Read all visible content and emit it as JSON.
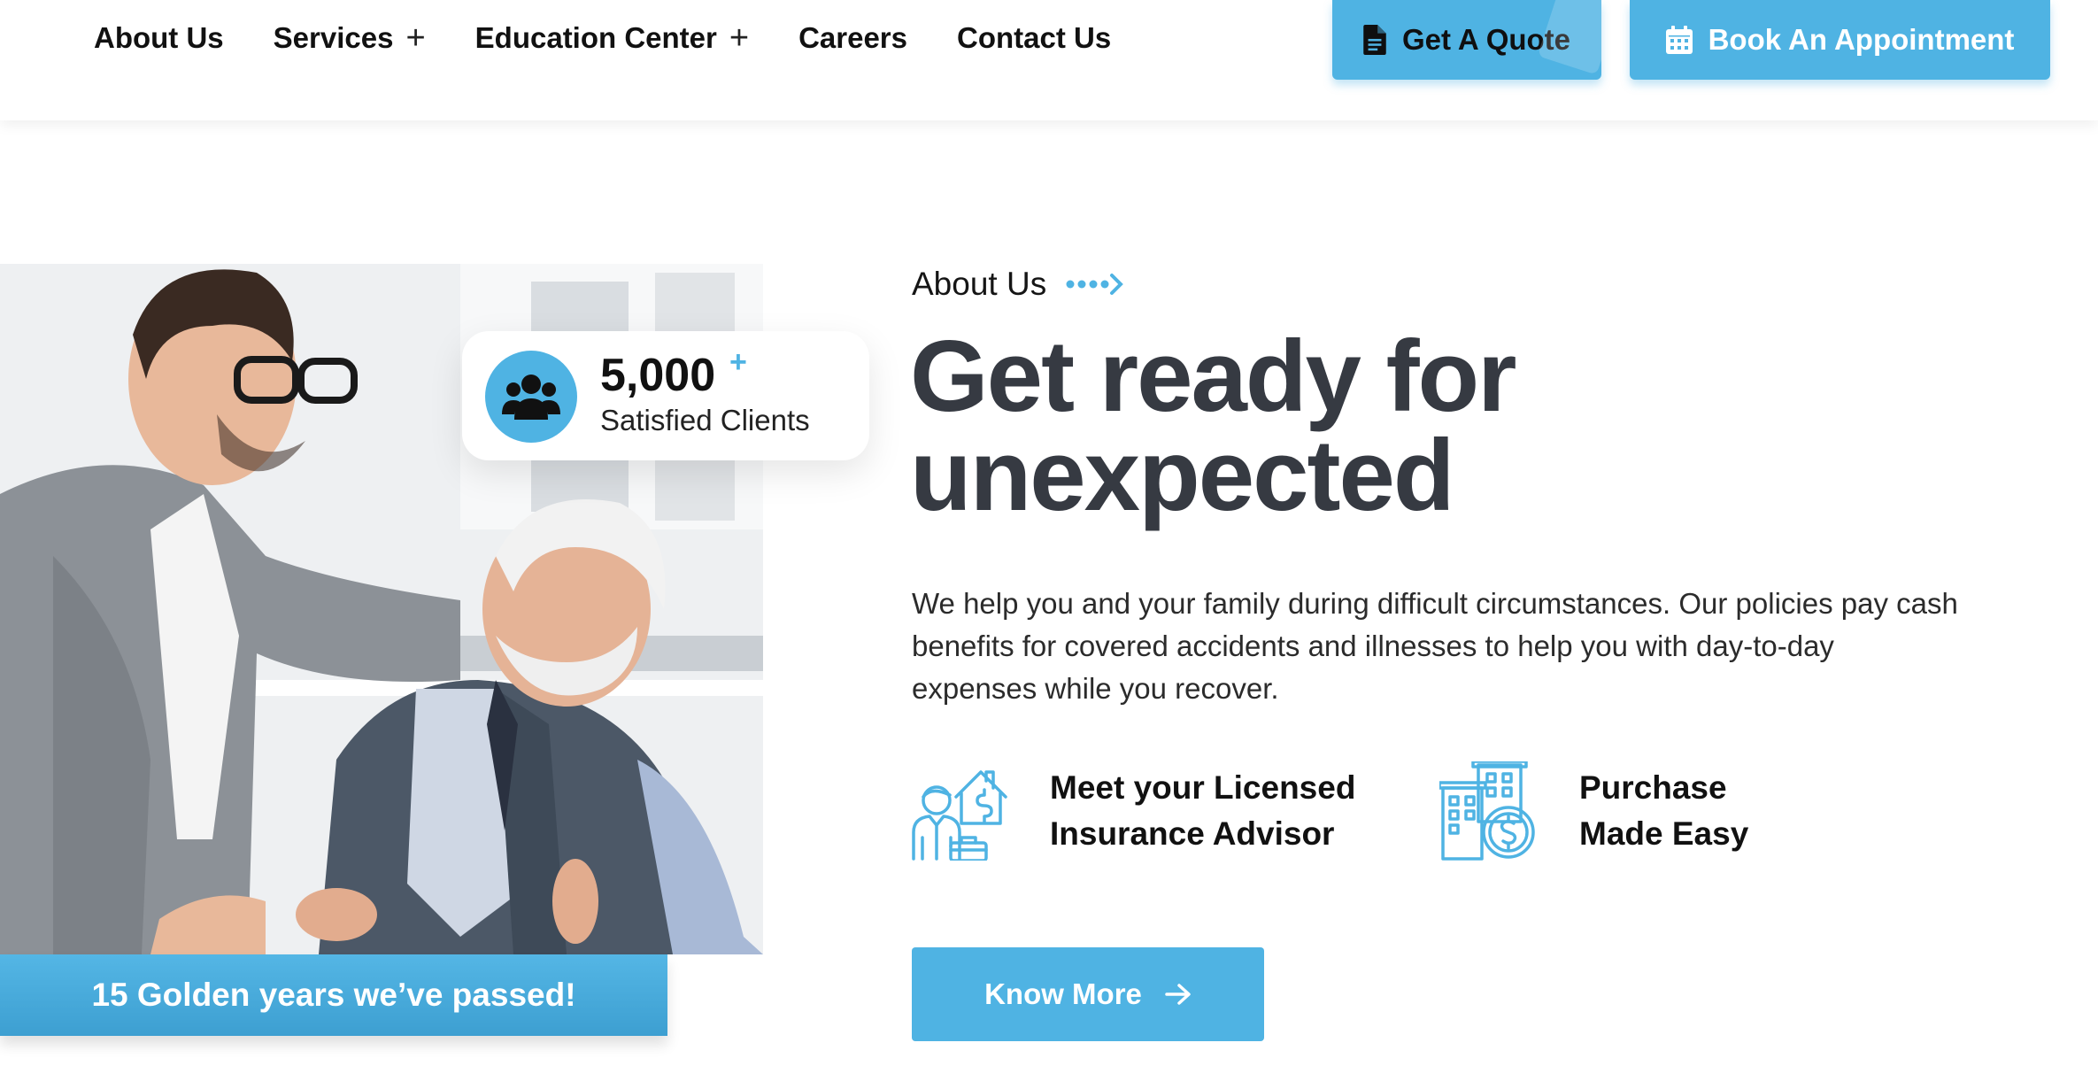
{
  "nav": {
    "items": [
      {
        "label": "About Us",
        "has_submenu": false
      },
      {
        "label": "Services",
        "has_submenu": true
      },
      {
        "label": "Education Center",
        "has_submenu": true
      },
      {
        "label": "Careers",
        "has_submenu": false
      },
      {
        "label": "Contact Us",
        "has_submenu": false
      }
    ],
    "submenu_symbol": "+"
  },
  "header_buttons": {
    "quote_label": "Get A Quote",
    "quote_icon": "document-icon",
    "appointment_label": "Book An Appointment",
    "appointment_icon": "calendar-icon"
  },
  "stats": {
    "number": "5,000",
    "suffix": "+",
    "label": "Satisfied Clients",
    "icon": "users-group-icon"
  },
  "golden_bar": {
    "text": "15 Golden years we’ve passed!"
  },
  "about": {
    "eyebrow": "About Us",
    "headline_line1": "Get ready for",
    "headline_line2": "unexpected",
    "body": "We help you and your family during difficult circumstances. Our policies pay cash benefits for covered accidents and illnesses to help you with day-to-day expenses while you recover.",
    "features": [
      {
        "line1": "Meet your Licensed",
        "line2": "Insurance Advisor",
        "icon": "advisor-house-icon"
      },
      {
        "line1": "Purchase",
        "line2": "Made Easy",
        "icon": "building-coin-icon"
      }
    ],
    "cta_label": "Know More"
  },
  "colors": {
    "accent": "#4fb3e3",
    "headline": "#363a42",
    "text": "#2b2b2b"
  }
}
